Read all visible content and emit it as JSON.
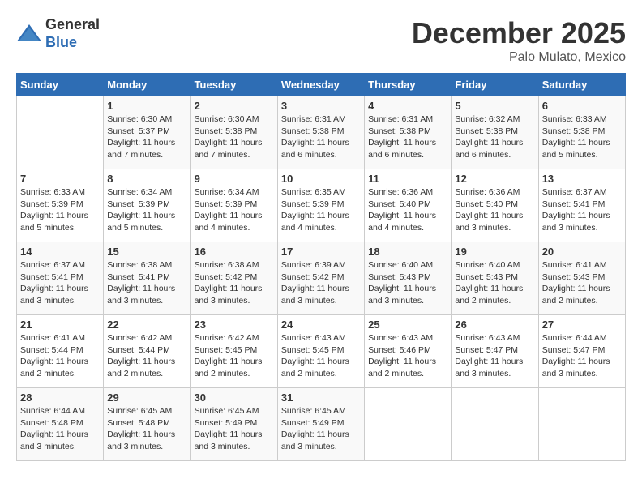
{
  "header": {
    "logo_line1": "General",
    "logo_line2": "Blue",
    "month": "December 2025",
    "location": "Palo Mulato, Mexico"
  },
  "days_of_week": [
    "Sunday",
    "Monday",
    "Tuesday",
    "Wednesday",
    "Thursday",
    "Friday",
    "Saturday"
  ],
  "weeks": [
    [
      {
        "day": "",
        "info": ""
      },
      {
        "day": "1",
        "sunrise": "6:30 AM",
        "sunset": "5:37 PM",
        "daylight": "11 hours and 7 minutes."
      },
      {
        "day": "2",
        "sunrise": "6:30 AM",
        "sunset": "5:38 PM",
        "daylight": "11 hours and 7 minutes."
      },
      {
        "day": "3",
        "sunrise": "6:31 AM",
        "sunset": "5:38 PM",
        "daylight": "11 hours and 6 minutes."
      },
      {
        "day": "4",
        "sunrise": "6:31 AM",
        "sunset": "5:38 PM",
        "daylight": "11 hours and 6 minutes."
      },
      {
        "day": "5",
        "sunrise": "6:32 AM",
        "sunset": "5:38 PM",
        "daylight": "11 hours and 6 minutes."
      },
      {
        "day": "6",
        "sunrise": "6:33 AM",
        "sunset": "5:38 PM",
        "daylight": "11 hours and 5 minutes."
      }
    ],
    [
      {
        "day": "7",
        "sunrise": "6:33 AM",
        "sunset": "5:39 PM",
        "daylight": "11 hours and 5 minutes."
      },
      {
        "day": "8",
        "sunrise": "6:34 AM",
        "sunset": "5:39 PM",
        "daylight": "11 hours and 5 minutes."
      },
      {
        "day": "9",
        "sunrise": "6:34 AM",
        "sunset": "5:39 PM",
        "daylight": "11 hours and 4 minutes."
      },
      {
        "day": "10",
        "sunrise": "6:35 AM",
        "sunset": "5:39 PM",
        "daylight": "11 hours and 4 minutes."
      },
      {
        "day": "11",
        "sunrise": "6:36 AM",
        "sunset": "5:40 PM",
        "daylight": "11 hours and 4 minutes."
      },
      {
        "day": "12",
        "sunrise": "6:36 AM",
        "sunset": "5:40 PM",
        "daylight": "11 hours and 3 minutes."
      },
      {
        "day": "13",
        "sunrise": "6:37 AM",
        "sunset": "5:41 PM",
        "daylight": "11 hours and 3 minutes."
      }
    ],
    [
      {
        "day": "14",
        "sunrise": "6:37 AM",
        "sunset": "5:41 PM",
        "daylight": "11 hours and 3 minutes."
      },
      {
        "day": "15",
        "sunrise": "6:38 AM",
        "sunset": "5:41 PM",
        "daylight": "11 hours and 3 minutes."
      },
      {
        "day": "16",
        "sunrise": "6:38 AM",
        "sunset": "5:42 PM",
        "daylight": "11 hours and 3 minutes."
      },
      {
        "day": "17",
        "sunrise": "6:39 AM",
        "sunset": "5:42 PM",
        "daylight": "11 hours and 3 minutes."
      },
      {
        "day": "18",
        "sunrise": "6:40 AM",
        "sunset": "5:43 PM",
        "daylight": "11 hours and 3 minutes."
      },
      {
        "day": "19",
        "sunrise": "6:40 AM",
        "sunset": "5:43 PM",
        "daylight": "11 hours and 2 minutes."
      },
      {
        "day": "20",
        "sunrise": "6:41 AM",
        "sunset": "5:43 PM",
        "daylight": "11 hours and 2 minutes."
      }
    ],
    [
      {
        "day": "21",
        "sunrise": "6:41 AM",
        "sunset": "5:44 PM",
        "daylight": "11 hours and 2 minutes."
      },
      {
        "day": "22",
        "sunrise": "6:42 AM",
        "sunset": "5:44 PM",
        "daylight": "11 hours and 2 minutes."
      },
      {
        "day": "23",
        "sunrise": "6:42 AM",
        "sunset": "5:45 PM",
        "daylight": "11 hours and 2 minutes."
      },
      {
        "day": "24",
        "sunrise": "6:43 AM",
        "sunset": "5:45 PM",
        "daylight": "11 hours and 2 minutes."
      },
      {
        "day": "25",
        "sunrise": "6:43 AM",
        "sunset": "5:46 PM",
        "daylight": "11 hours and 2 minutes."
      },
      {
        "day": "26",
        "sunrise": "6:43 AM",
        "sunset": "5:47 PM",
        "daylight": "11 hours and 3 minutes."
      },
      {
        "day": "27",
        "sunrise": "6:44 AM",
        "sunset": "5:47 PM",
        "daylight": "11 hours and 3 minutes."
      }
    ],
    [
      {
        "day": "28",
        "sunrise": "6:44 AM",
        "sunset": "5:48 PM",
        "daylight": "11 hours and 3 minutes."
      },
      {
        "day": "29",
        "sunrise": "6:45 AM",
        "sunset": "5:48 PM",
        "daylight": "11 hours and 3 minutes."
      },
      {
        "day": "30",
        "sunrise": "6:45 AM",
        "sunset": "5:49 PM",
        "daylight": "11 hours and 3 minutes."
      },
      {
        "day": "31",
        "sunrise": "6:45 AM",
        "sunset": "5:49 PM",
        "daylight": "11 hours and 3 minutes."
      },
      {
        "day": "",
        "info": ""
      },
      {
        "day": "",
        "info": ""
      },
      {
        "day": "",
        "info": ""
      }
    ]
  ],
  "labels": {
    "sunrise": "Sunrise:",
    "sunset": "Sunset:",
    "daylight": "Daylight:"
  }
}
